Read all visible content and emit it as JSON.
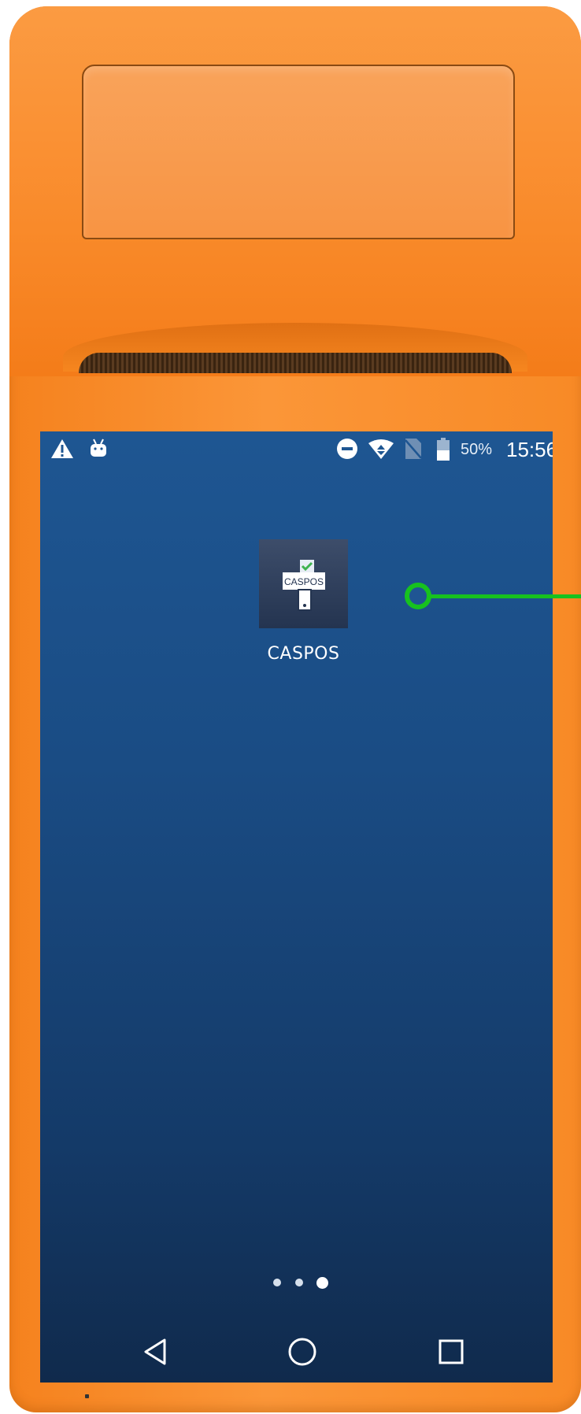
{
  "device": {
    "accent_color": "#f88a26",
    "screen_color": "#1a4c84"
  },
  "status_bar": {
    "left_icons": [
      "warning-icon",
      "android-debug-icon"
    ],
    "right_icons": [
      "do-not-disturb-icon",
      "wifi-icon",
      "no-sim-icon",
      "battery-icon"
    ],
    "battery": "50%",
    "time": "15:56"
  },
  "home_screen": {
    "apps": [
      {
        "label": "CASPOS",
        "icon_text": "CASPOS",
        "icon": "caspos-app-icon"
      }
    ],
    "page_indicator": {
      "pages": 3,
      "current": 3
    }
  },
  "nav_bar": {
    "buttons": [
      "back-icon",
      "home-icon",
      "recents-icon"
    ]
  },
  "annotation": {
    "color": "#17c21f",
    "target": "CASPOS"
  }
}
